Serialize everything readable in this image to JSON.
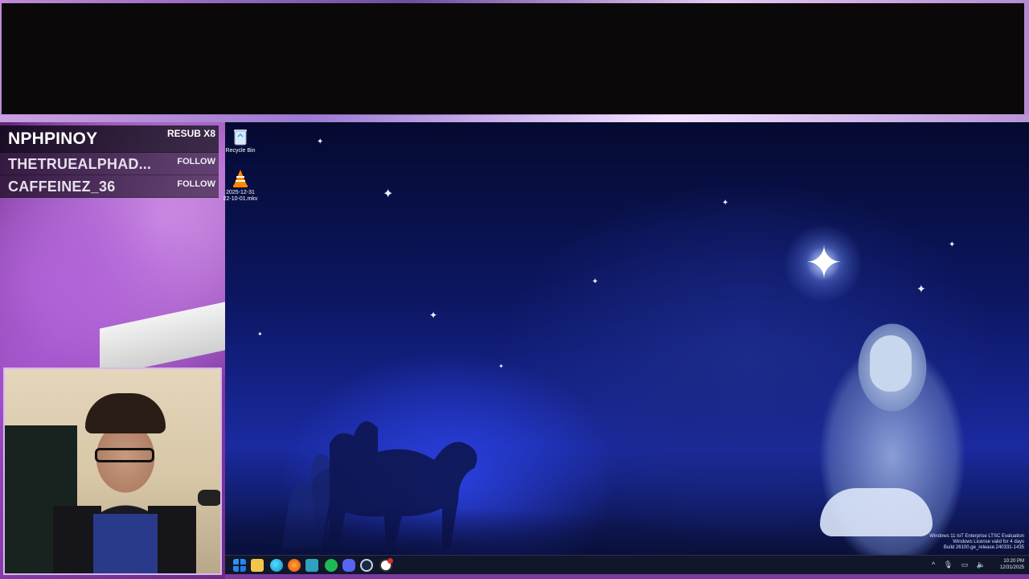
{
  "alerts": {
    "rows": [
      {
        "name": "NPHPINOY",
        "tag": "RESUB X8"
      },
      {
        "name": "THETRUEALPHAD...",
        "tag": "FOLLOW"
      },
      {
        "name": "CAFFEINEZ_36",
        "tag": "FOLLOW"
      }
    ]
  },
  "desktop": {
    "icons": [
      {
        "label": "Recycle Bin",
        "icon": "recycle-bin-icon"
      },
      {
        "label": "2025-12-31 22-10-01.mkv",
        "icon": "vlc-icon"
      }
    ],
    "watermark": {
      "line1": "Windows 11 IoT Enterprise LTSC Evaluation",
      "line2": "Windows License valid for 4 days",
      "line3": "Build 26100.ge_release.240331-1435"
    }
  },
  "taskbar": {
    "apps": [
      {
        "name": "Start",
        "icon": "windows-start-icon"
      },
      {
        "name": "File Explorer",
        "icon": "folder-icon"
      },
      {
        "name": "Microsoft Edge",
        "icon": "edge-icon"
      },
      {
        "name": "Firefox",
        "icon": "firefox-icon"
      },
      {
        "name": "App",
        "icon": "app-icon"
      },
      {
        "name": "Spotify",
        "icon": "spotify-icon"
      },
      {
        "name": "Discord",
        "icon": "discord-icon"
      },
      {
        "name": "Steam",
        "icon": "steam-icon"
      },
      {
        "name": "App",
        "icon": "record-icon"
      }
    ],
    "tray": {
      "chevron": "^",
      "mic": "🎙",
      "network": "▭",
      "volume": "🔈"
    },
    "clock": {
      "time": "10:20 PM",
      "date": "12/31/2025"
    }
  },
  "colors": {
    "taskbar": "#11162a",
    "desktop_sky": "#0c1660",
    "accent_purple": "#9a48c0"
  }
}
